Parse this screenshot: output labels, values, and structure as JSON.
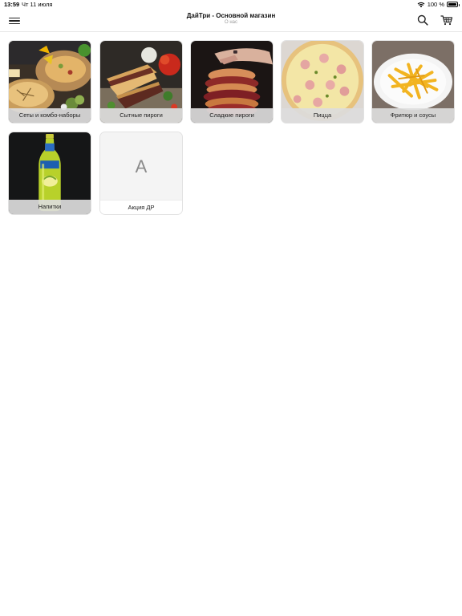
{
  "status_bar": {
    "time": "13:59",
    "date": "Чт 11 июля",
    "battery": "100 %"
  },
  "header": {
    "title": "ДайТри - Основной магазин",
    "subtitle": "О нас",
    "icons": {
      "menu": "hamburger-menu-icon",
      "search": "search-icon",
      "cart": "cart-icon"
    }
  },
  "categories": [
    {
      "label": "Сеты и комбо-наборы",
      "image": "combo-sets-photo"
    },
    {
      "label": "Сытные пироги",
      "image": "savory-pies-photo"
    },
    {
      "label": "Сладкие пироги",
      "image": "sweet-pies-photo"
    },
    {
      "label": "Пицца",
      "image": "pizza-photo"
    },
    {
      "label": "Фритюр и соусы",
      "image": "fries-photo"
    },
    {
      "label": "Напитки",
      "image": "drink-bottle-photo"
    },
    {
      "label": "Акция ДР",
      "placeholder_letter": "А"
    }
  ]
}
